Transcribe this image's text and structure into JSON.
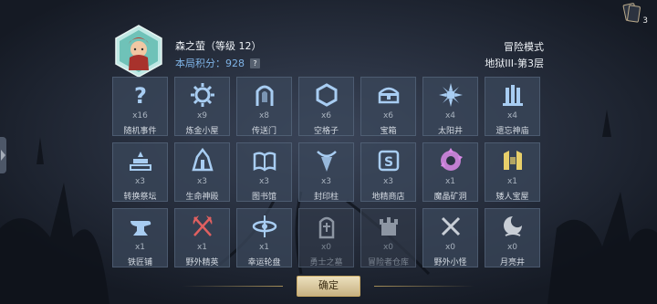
{
  "header": {
    "player_name": "森之萤（等级 12）",
    "score_label": "本局积分：928",
    "help_badge": "?",
    "mode": "冒险模式",
    "floor": "地狱III-第3层"
  },
  "deck": {
    "count": "3",
    "icon": "card-deck-icon"
  },
  "rooms": [
    {
      "icon": "question-icon",
      "count": "x16",
      "label": "随机事件",
      "color": "#a8cdf2"
    },
    {
      "icon": "gear-icon",
      "count": "x9",
      "label": "炼金小屋",
      "color": "#a8cdf2"
    },
    {
      "icon": "portal-icon",
      "count": "x8",
      "label": "传送门",
      "color": "#a8cdf2"
    },
    {
      "icon": "hexagon-icon",
      "count": "x6",
      "label": "空格子",
      "color": "#a8cdf2"
    },
    {
      "icon": "treasure-chest-icon",
      "count": "x6",
      "label": "宝箱",
      "color": "#a8cdf2"
    },
    {
      "icon": "sun-well-icon",
      "count": "x4",
      "label": "太阳井",
      "color": "#a8cdf2"
    },
    {
      "icon": "temple-icon",
      "count": "x4",
      "label": "遗忘神庙",
      "color": "#a8cdf2"
    },
    {
      "icon": "altar-icon",
      "count": "x3",
      "label": "转换祭坛",
      "color": "#a8cdf2"
    },
    {
      "icon": "life-shrine-icon",
      "count": "x3",
      "label": "生命神殿",
      "color": "#a8cdf2"
    },
    {
      "icon": "book-icon",
      "count": "x3",
      "label": "图书馆",
      "color": "#a8cdf2"
    },
    {
      "icon": "seal-pillar-icon",
      "count": "x3",
      "label": "封印柱",
      "color": "#a8cdf2"
    },
    {
      "icon": "spirit-shop-icon",
      "count": "x3",
      "label": "地精商店",
      "color": "#a8cdf2"
    },
    {
      "icon": "crystal-cave-icon",
      "count": "x1",
      "label": "魔晶矿洞",
      "color": "#d98ae8"
    },
    {
      "icon": "dwarf-vault-icon",
      "count": "x1",
      "label": "矮人宝屋",
      "color": "#e8cf6a"
    },
    {
      "icon": "anvil-icon",
      "count": "x1",
      "label": "铁匠铺",
      "color": "#a8cdf2"
    },
    {
      "icon": "crossed-axes-icon",
      "count": "x1",
      "label": "野外精英",
      "color": "#e06060"
    },
    {
      "icon": "wheel-icon",
      "count": "x1",
      "label": "幸运轮盘",
      "color": "#a8cdf2"
    },
    {
      "icon": "tombstone-icon",
      "count": "x0",
      "label": "勇士之墓",
      "color": "#8d96a3"
    },
    {
      "icon": "warehouse-icon",
      "count": "x0",
      "label": "冒险者仓库",
      "color": "#8d96a3"
    },
    {
      "icon": "crossed-swords-icon",
      "count": "x0",
      "label": "野外小怪",
      "color": "#c8ced6"
    },
    {
      "icon": "moon-well-icon",
      "count": "x0",
      "label": "月亮井",
      "color": "#c8ced6"
    }
  ],
  "confirm_label": "确定"
}
